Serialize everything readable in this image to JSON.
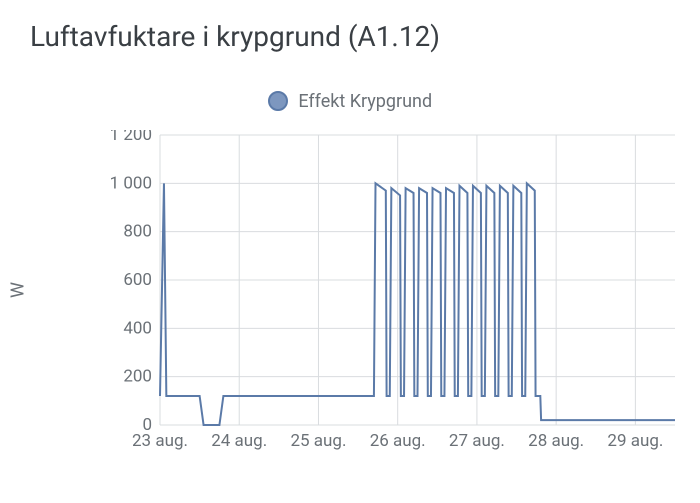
{
  "title": "Luftavfuktare i krypgrund (A1.12)",
  "legend": {
    "label": "Effekt Krypgrund"
  },
  "ylabel": "W",
  "chart_data": {
    "type": "line",
    "title": "Luftavfuktare i krypgrund (A1.12)",
    "xlabel": "",
    "ylabel": "W",
    "ylim": [
      0,
      1200
    ],
    "xrange": [
      "23 aug.",
      "29 aug."
    ],
    "xticks": [
      "23 aug.",
      "24 aug.",
      "25 aug.",
      "26 aug.",
      "27 aug.",
      "28 aug.",
      "29 aug."
    ],
    "yticks": [
      0,
      200,
      400,
      600,
      800,
      1000,
      1200
    ],
    "series": [
      {
        "name": "Effekt Krypgrund",
        "color": "#5b7aa8",
        "points": [
          {
            "x": 23.0,
            "y": 120
          },
          {
            "x": 23.05,
            "y": 1000
          },
          {
            "x": 23.08,
            "y": 120
          },
          {
            "x": 23.5,
            "y": 120
          },
          {
            "x": 23.55,
            "y": 0
          },
          {
            "x": 23.75,
            "y": 0
          },
          {
            "x": 23.8,
            "y": 120
          },
          {
            "x": 25.7,
            "y": 120
          },
          {
            "x": 25.72,
            "y": 1000
          },
          {
            "x": 25.85,
            "y": 970
          },
          {
            "x": 25.86,
            "y": 120
          },
          {
            "x": 25.9,
            "y": 120
          },
          {
            "x": 25.92,
            "y": 980
          },
          {
            "x": 26.03,
            "y": 950
          },
          {
            "x": 26.04,
            "y": 120
          },
          {
            "x": 26.08,
            "y": 120
          },
          {
            "x": 26.1,
            "y": 980
          },
          {
            "x": 26.2,
            "y": 960
          },
          {
            "x": 26.21,
            "y": 120
          },
          {
            "x": 26.25,
            "y": 120
          },
          {
            "x": 26.27,
            "y": 980
          },
          {
            "x": 26.37,
            "y": 960
          },
          {
            "x": 26.38,
            "y": 120
          },
          {
            "x": 26.42,
            "y": 120
          },
          {
            "x": 26.44,
            "y": 980
          },
          {
            "x": 26.54,
            "y": 960
          },
          {
            "x": 26.55,
            "y": 120
          },
          {
            "x": 26.59,
            "y": 120
          },
          {
            "x": 26.61,
            "y": 980
          },
          {
            "x": 26.71,
            "y": 960
          },
          {
            "x": 26.72,
            "y": 120
          },
          {
            "x": 26.76,
            "y": 120
          },
          {
            "x": 26.78,
            "y": 990
          },
          {
            "x": 26.88,
            "y": 960
          },
          {
            "x": 26.89,
            "y": 120
          },
          {
            "x": 26.93,
            "y": 120
          },
          {
            "x": 26.95,
            "y": 990
          },
          {
            "x": 27.05,
            "y": 960
          },
          {
            "x": 27.06,
            "y": 120
          },
          {
            "x": 27.1,
            "y": 120
          },
          {
            "x": 27.12,
            "y": 990
          },
          {
            "x": 27.22,
            "y": 960
          },
          {
            "x": 27.23,
            "y": 120
          },
          {
            "x": 27.27,
            "y": 120
          },
          {
            "x": 27.29,
            "y": 990
          },
          {
            "x": 27.39,
            "y": 960
          },
          {
            "x": 27.4,
            "y": 120
          },
          {
            "x": 27.44,
            "y": 120
          },
          {
            "x": 27.46,
            "y": 990
          },
          {
            "x": 27.56,
            "y": 960
          },
          {
            "x": 27.57,
            "y": 120
          },
          {
            "x": 27.61,
            "y": 120
          },
          {
            "x": 27.63,
            "y": 1000
          },
          {
            "x": 27.73,
            "y": 970
          },
          {
            "x": 27.74,
            "y": 120
          },
          {
            "x": 27.8,
            "y": 120
          },
          {
            "x": 27.81,
            "y": 20
          },
          {
            "x": 29.5,
            "y": 20
          }
        ]
      }
    ]
  }
}
